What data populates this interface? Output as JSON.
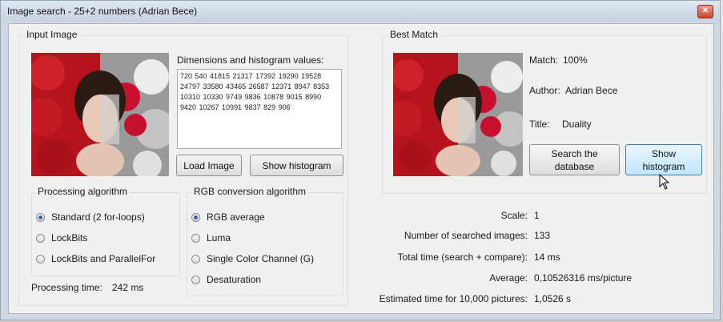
{
  "window": {
    "title": "Image search - 25+2 numbers (Adrian Bece)",
    "close_glyph": "✕"
  },
  "input_image": {
    "group_label": "Input Image",
    "dimensions_label": "Dimensions and histogram values:",
    "histogram_text": "720 540 41815 21317 17392 19290 19528 24797 33580 43465 26587 12371 8947 8353 10310 10330 9749 9836 10878 9015 8990 9420 10267 10991 9837 829 906",
    "load_button": "Load Image",
    "show_histogram_button": "Show histogram"
  },
  "processing": {
    "group_label": "Processing algorithm",
    "options": [
      "Standard (2 for-loops)",
      "LockBits",
      "LockBits and ParallelFor"
    ],
    "selected_index": 0,
    "time_label": "Processing time:",
    "time_value": "242 ms"
  },
  "rgb_conversion": {
    "group_label": "RGB conversion algorithm",
    "options": [
      "RGB average",
      "Luma",
      "Single Color Channel (G)",
      "Desaturation"
    ],
    "selected_index": 0
  },
  "best_match": {
    "group_label": "Best Match",
    "match_label": "Match:",
    "match_value": "100%",
    "author_label": "Author:",
    "author_value": "Adrian Bece",
    "title_label": "Title:",
    "title_value": "Duality",
    "search_button": "Search the database",
    "show_histogram_button": "Show histogram"
  },
  "stats": {
    "scale_label": "Scale:",
    "scale_value": "1",
    "searched_label": "Number of searched images:",
    "searched_value": "133",
    "total_label": "Total time (search + compare):",
    "total_value": "14 ms",
    "average_label": "Average:",
    "average_value": "0,10526316 ms/picture",
    "estimated_label": "Estimated time for 10,000 pictures:",
    "estimated_value": "1,0526 s"
  },
  "colors": {
    "accent": "#2b61b0",
    "button_focus": "#bee6fd"
  },
  "icons": {
    "cursor": "mouse-pointer-icon",
    "close": "close-icon"
  }
}
